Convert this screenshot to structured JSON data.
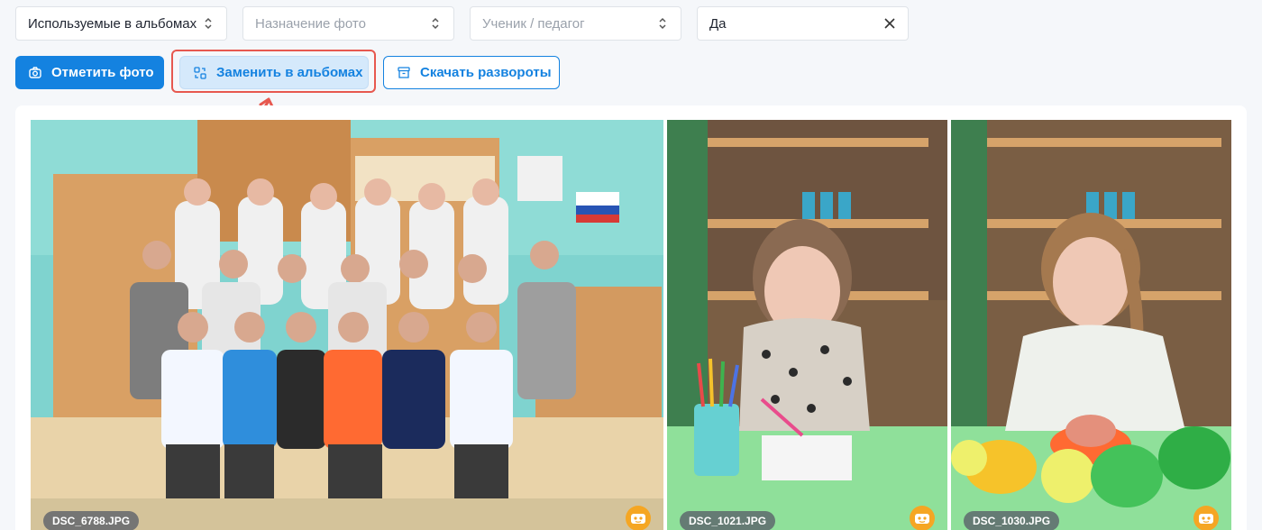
{
  "filters": [
    {
      "value": "Используемые в альбомах",
      "placeholder": false
    },
    {
      "value": "Назначение фото",
      "placeholder": true
    },
    {
      "value": "Ученик / педагог",
      "placeholder": true
    },
    {
      "value": "Да",
      "placeholder": false
    }
  ],
  "toolbar": {
    "mark_photo": "Отметить фото",
    "replace_in_albums": "Заменить в альбомах",
    "download_spreads": "Скачать развороты"
  },
  "photos": [
    {
      "filename": "DSC_6788.JPG"
    },
    {
      "filename": "DSC_1021.JPG"
    },
    {
      "filename": "DSC_1030.JPG"
    }
  ],
  "colors": {
    "accent": "#1482e0",
    "highlight": "#e7584f",
    "badge": "#f5a623"
  },
  "icons": [
    "chevrons-updown-icon",
    "close-icon",
    "camera-tag-icon",
    "replace-icon",
    "archive-icon",
    "face-icon",
    "arrow-pointer-icon"
  ]
}
